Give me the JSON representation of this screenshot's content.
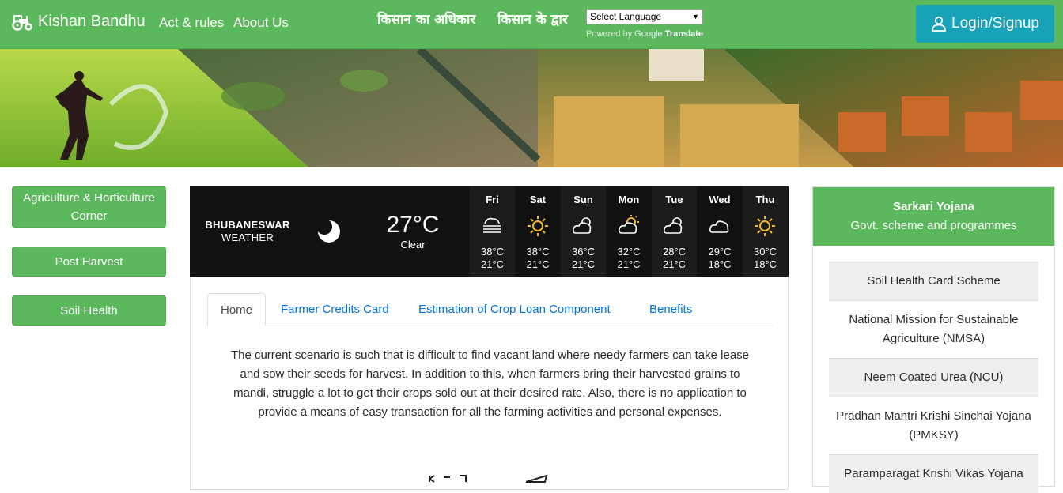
{
  "navbar": {
    "brand": "Kishan Bandhu",
    "links": [
      "Act & rules",
      "About Us"
    ],
    "hindi_1": "किसान का अधिकार",
    "hindi_2": "किसान के द्वार",
    "language_select": "Select Language",
    "powered_by": "Powered by",
    "google": "Google",
    "translate": "Translate",
    "login": "Login/Signup"
  },
  "sidebar": {
    "buttons": [
      "Agriculture & Horticulture Corner",
      "Post Harvest",
      "Soil Health"
    ]
  },
  "weather": {
    "city": "BHUBANESWAR",
    "label": "WEATHER",
    "temp": "27°C",
    "condition": "Clear",
    "icon": "moon-icon",
    "days": [
      {
        "name": "Fri",
        "icon": "fog-icon",
        "high": "38°C",
        "low": "21°C"
      },
      {
        "name": "Sat",
        "icon": "sun-icon",
        "high": "38°C",
        "low": "21°C"
      },
      {
        "name": "Sun",
        "icon": "cloudy-sun-icon",
        "high": "36°C",
        "low": "21°C"
      },
      {
        "name": "Mon",
        "icon": "partly-sunny-icon",
        "high": "32°C",
        "low": "21°C"
      },
      {
        "name": "Tue",
        "icon": "cloudy-sun-icon",
        "high": "28°C",
        "low": "21°C"
      },
      {
        "name": "Wed",
        "icon": "cloud-icon",
        "high": "29°C",
        "low": "18°C"
      },
      {
        "name": "Thu",
        "icon": "sun-icon",
        "high": "30°C",
        "low": "18°C"
      }
    ]
  },
  "tabs": [
    "Home",
    "Farmer Credits Card",
    "Estimation of Crop Loan Component",
    "Benefits"
  ],
  "content": {
    "paragraph": "The current scenario is such that is difficult to find vacant land where needy farmers can take lease and sow their seeds for harvest. In addition to this, when farmers bring their harvested grains to mandi, struggle a lot to get their crops sold out at their desired rate. Also, there is no application to provide a means of easy transaction for all the farming activities and personal expenses."
  },
  "right_panel": {
    "title": "Sarkari Yojana",
    "subtitle": "Govt. scheme and programmes",
    "items": [
      "Soil Health Card Scheme",
      "National Mission for Sustainable Agriculture (NMSA)",
      "Neem Coated Urea (NCU)",
      "Pradhan Mantri Krishi Sinchai Yojana (PMKSY)",
      "Paramparagat Krishi Vikas Yojana"
    ]
  },
  "colors": {
    "navbar": "#5cb85c",
    "login": "#17a2b8",
    "link": "#0275d8",
    "weather_bg": "#111111"
  }
}
